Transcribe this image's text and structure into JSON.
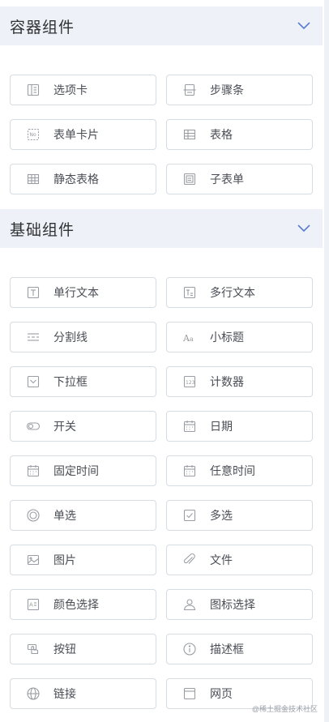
{
  "sections": [
    {
      "title": "容器组件",
      "items": [
        {
          "label": "选项卡",
          "icon": "tabs-icon"
        },
        {
          "label": "步骤条",
          "icon": "steps-icon"
        },
        {
          "label": "表单卡片",
          "icon": "form-card-icon"
        },
        {
          "label": "表格",
          "icon": "table-icon"
        },
        {
          "label": "静态表格",
          "icon": "static-table-icon"
        },
        {
          "label": "子表单",
          "icon": "subform-icon"
        }
      ]
    },
    {
      "title": "基础组件",
      "items": [
        {
          "label": "单行文本",
          "icon": "text-input-icon"
        },
        {
          "label": "多行文本",
          "icon": "textarea-icon"
        },
        {
          "label": "分割线",
          "icon": "divider-icon"
        },
        {
          "label": "小标题",
          "icon": "subtitle-icon"
        },
        {
          "label": "下拉框",
          "icon": "select-icon"
        },
        {
          "label": "计数器",
          "icon": "counter-icon"
        },
        {
          "label": "开关",
          "icon": "switch-icon"
        },
        {
          "label": "日期",
          "icon": "calendar-icon"
        },
        {
          "label": "固定时间",
          "icon": "calendar-icon"
        },
        {
          "label": "任意时间",
          "icon": "calendar-icon"
        },
        {
          "label": "单选",
          "icon": "radio-icon"
        },
        {
          "label": "多选",
          "icon": "checkbox-icon"
        },
        {
          "label": "图片",
          "icon": "image-icon"
        },
        {
          "label": "文件",
          "icon": "paperclip-icon"
        },
        {
          "label": "颜色选择",
          "icon": "color-picker-icon"
        },
        {
          "label": "图标选择",
          "icon": "icon-picker-icon"
        },
        {
          "label": "按钮",
          "icon": "button-icon"
        },
        {
          "label": "描述框",
          "icon": "info-icon"
        },
        {
          "label": "链接",
          "icon": "globe-icon"
        },
        {
          "label": "网页",
          "icon": "webpage-icon"
        }
      ]
    }
  ],
  "watermark": "@稀土掘金技术社区"
}
